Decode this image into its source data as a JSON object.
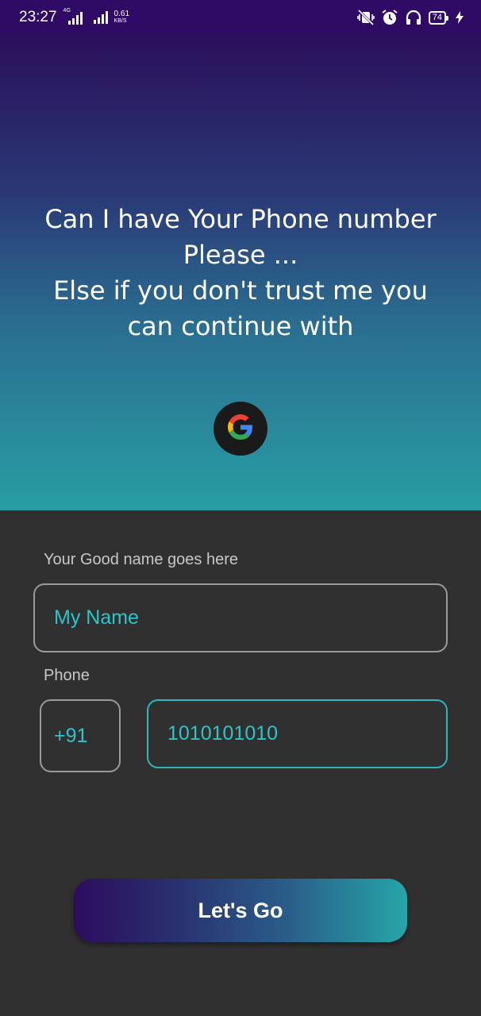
{
  "status_bar": {
    "time": "23:27",
    "network_type": "4G",
    "net_speed_value": "0.61",
    "net_speed_unit": "KB/S",
    "battery": "74"
  },
  "hero": {
    "lines": [
      "Can I have Your Phone number",
      "Please ...",
      "Else if you don't trust me you",
      "can continue with"
    ]
  },
  "form": {
    "name_label": "Your Good name goes here",
    "name_value": "My Name",
    "phone_label": "Phone",
    "country_code": "+91",
    "phone_value": "1010101010",
    "submit_label": "Let's Go"
  },
  "colors": {
    "accent": "#2cc6c8",
    "status_bar": "#2f0b66",
    "background": "#303030"
  },
  "icons": [
    "muted-vibrate-icon",
    "alarm-icon",
    "headphones-icon",
    "charging-icon",
    "google-icon"
  ]
}
